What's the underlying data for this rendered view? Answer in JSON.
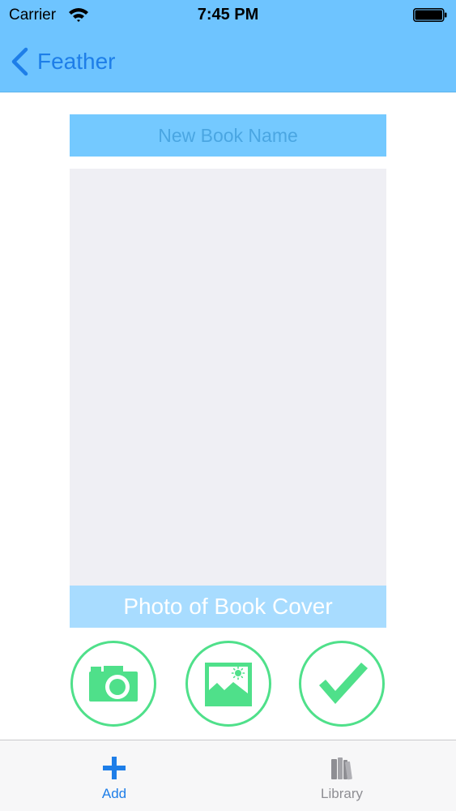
{
  "status_bar": {
    "carrier": "Carrier",
    "time": "7:45 PM"
  },
  "nav_bar": {
    "back_label": "Feather"
  },
  "form": {
    "book_name_placeholder": "New Book Name",
    "book_name_value": "",
    "cover_caption": "Photo of Book Cover"
  },
  "actions": [
    {
      "name": "take-photo",
      "icon": "camera-icon"
    },
    {
      "name": "choose-photo",
      "icon": "image-icon"
    },
    {
      "name": "confirm",
      "icon": "checkmark-icon"
    }
  ],
  "tab_bar": {
    "tabs": [
      {
        "label": "Add",
        "icon": "plus-icon",
        "selected": true
      },
      {
        "label": "Library",
        "icon": "books-icon",
        "selected": false
      }
    ]
  },
  "colors": {
    "nav_background": "#6ec4ff",
    "tint": "#1e7ee8",
    "field_background": "#74c9ff",
    "cover_background": "#efeff4",
    "caption_background": "#a8dcff",
    "action_green": "#4fe08a"
  }
}
